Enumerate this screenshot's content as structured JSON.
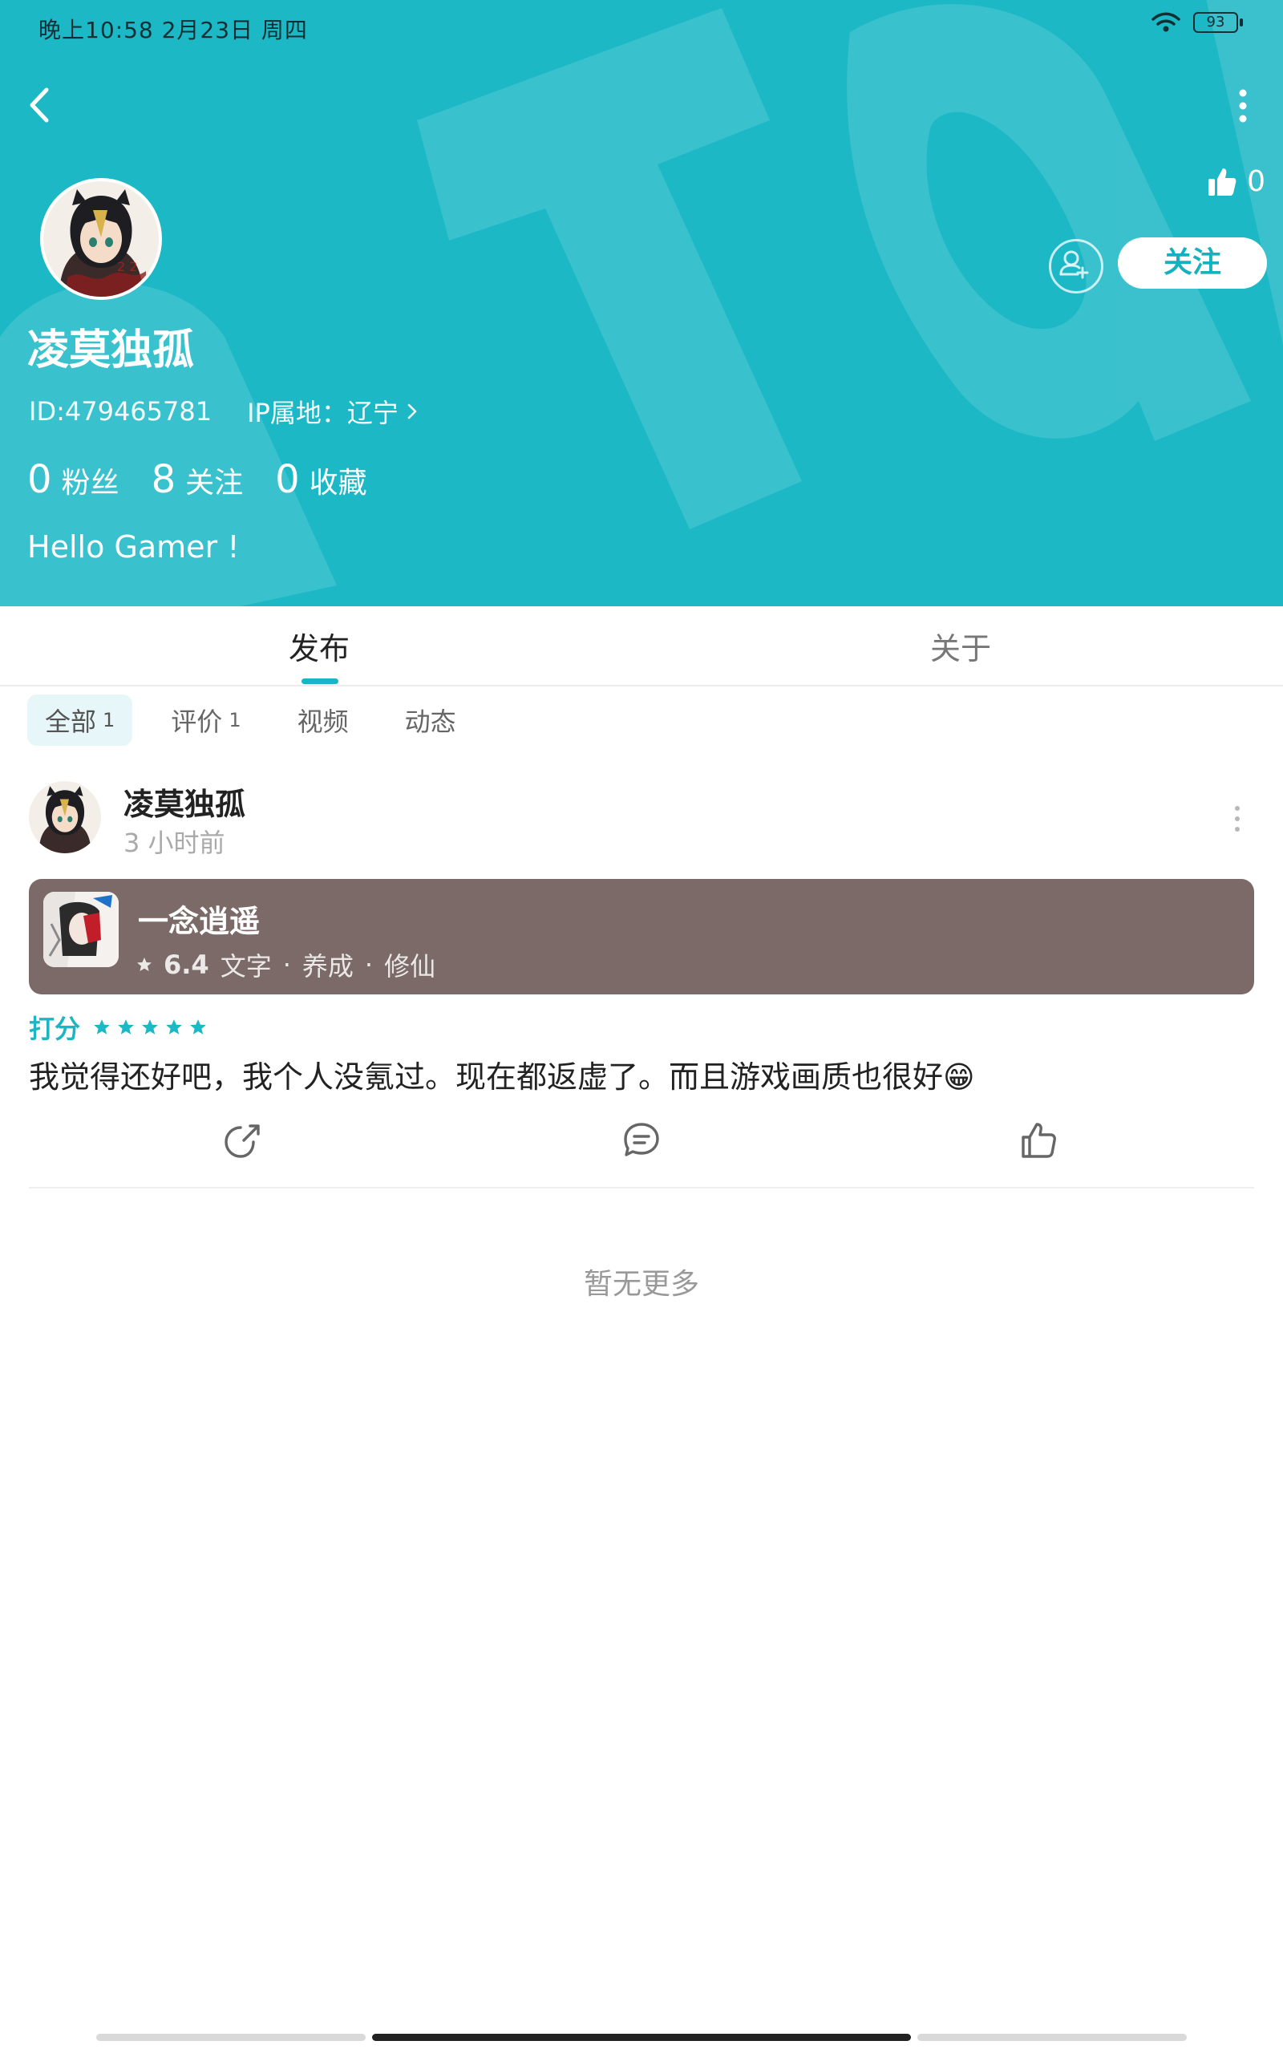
{
  "status_bar": {
    "time_date": "晚上10:58  2月23日 周四",
    "battery": "93"
  },
  "header": {
    "like_count": "0",
    "follow_label": "关注",
    "username": "凌莫独孤",
    "id_text": "ID:479465781",
    "ip_text": "IP属地：辽宁",
    "stats": [
      {
        "num": "0",
        "label": "粉丝"
      },
      {
        "num": "8",
        "label": "关注"
      },
      {
        "num": "0",
        "label": "收藏"
      }
    ],
    "bio": "Hello Gamer !"
  },
  "tabs": [
    {
      "label": "发布"
    },
    {
      "label": "关于"
    }
  ],
  "filters": [
    {
      "label": "全部",
      "count": "1"
    },
    {
      "label": "评价",
      "count": "1"
    },
    {
      "label": "视频",
      "count": ""
    },
    {
      "label": "动态",
      "count": ""
    }
  ],
  "post": {
    "author": "凌莫独孤",
    "time": "3 小时前",
    "game": {
      "title": "一念逍遥",
      "score": "6.4",
      "tags": [
        "文字",
        "养成",
        "修仙"
      ]
    },
    "rating_label": "打分",
    "rating_stars": 5,
    "review_text": "我觉得还好吧，我个人没氪过。现在都返虚了。而且游戏画质也很好😁"
  },
  "footer_text": "暂无更多",
  "colors": {
    "accent": "#1cb8c6",
    "card_bg": "#7b6a67"
  }
}
